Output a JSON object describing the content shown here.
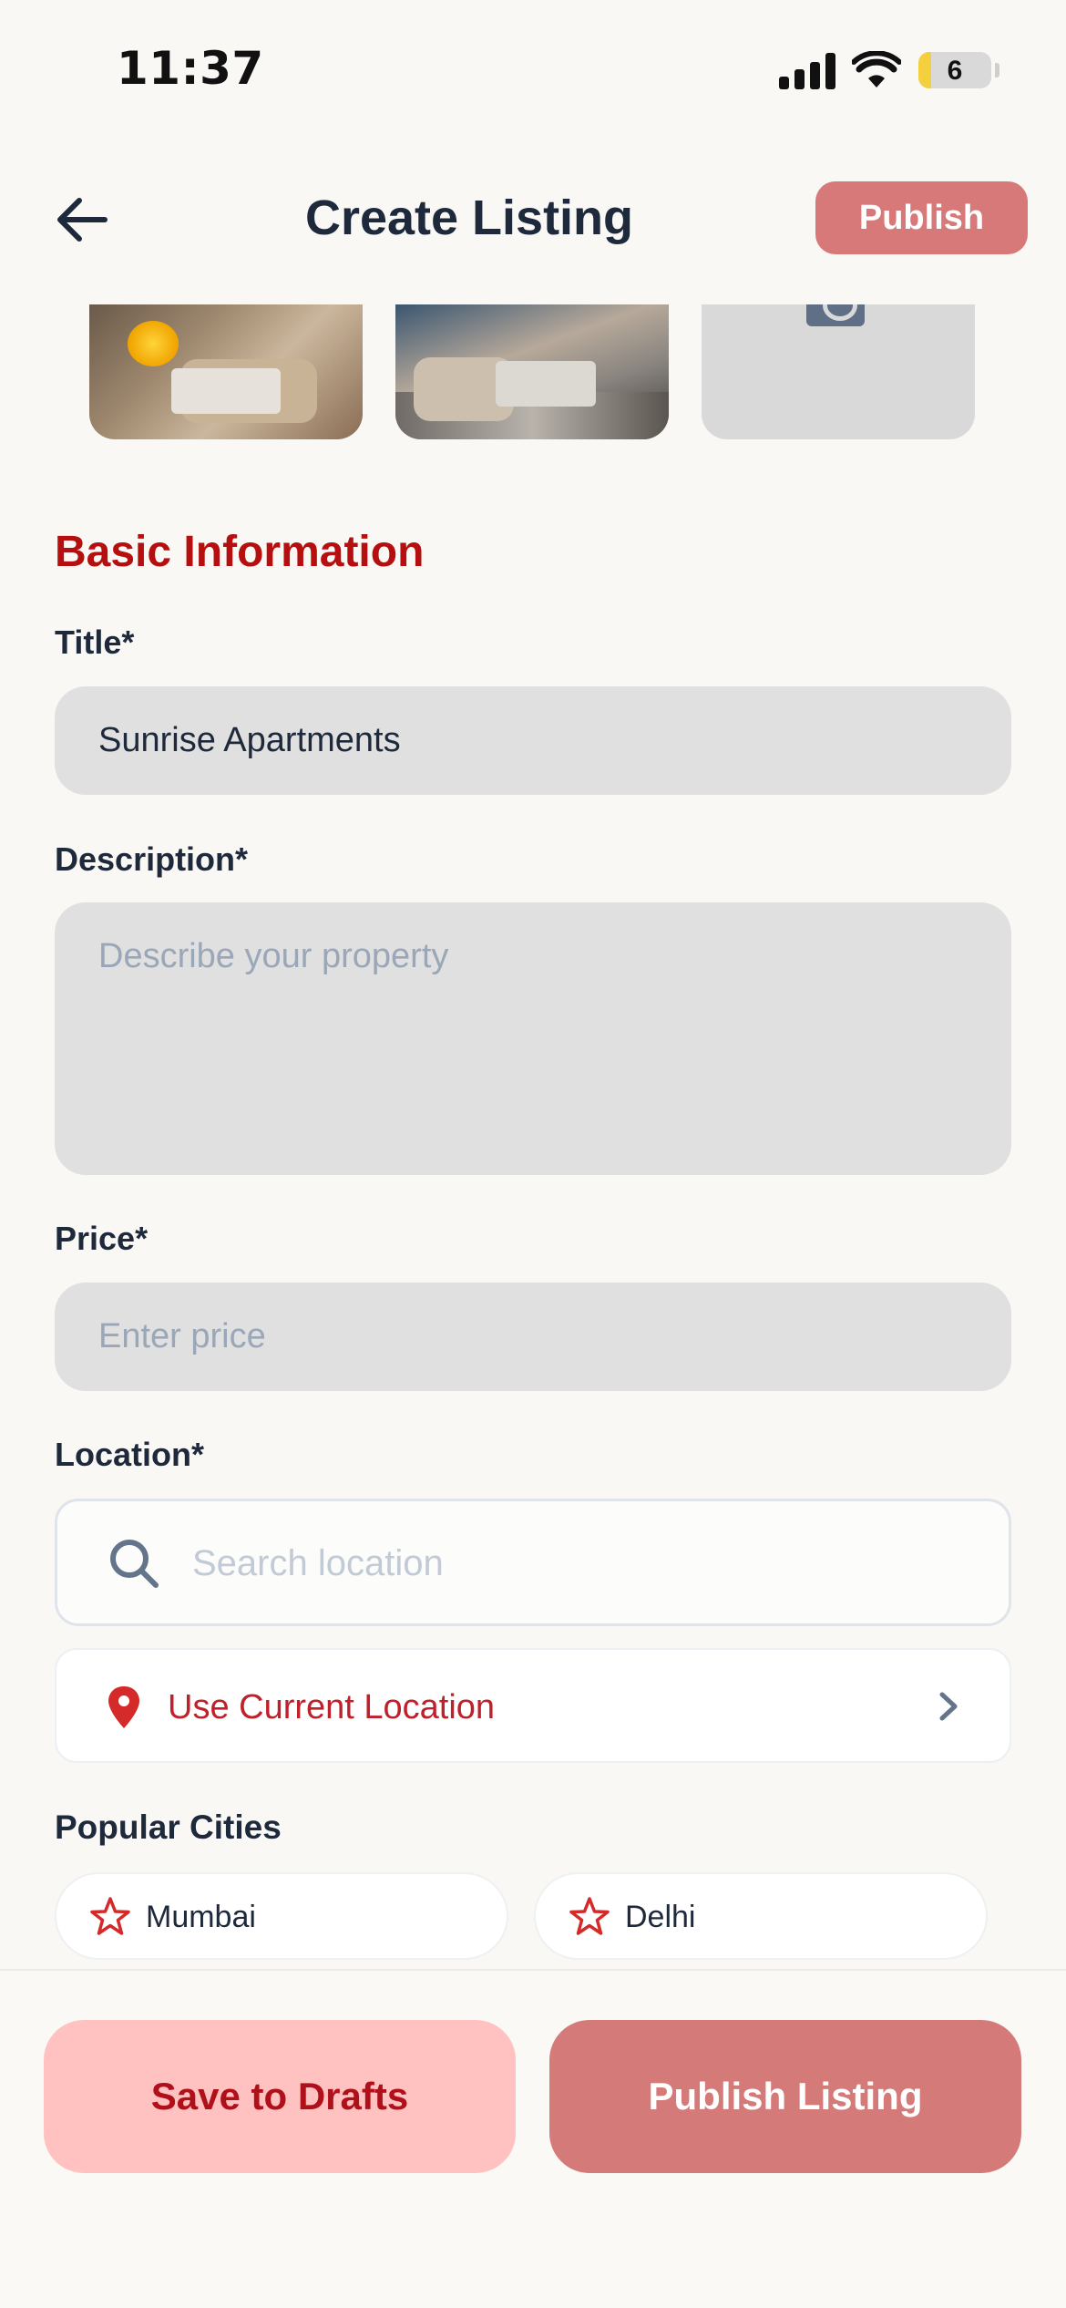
{
  "status_bar": {
    "time": "11:37",
    "battery_level": "6",
    "icons": [
      "signal-icon",
      "wifi-icon",
      "battery-icon"
    ]
  },
  "header": {
    "title": "Create Listing",
    "back_icon": "arrow-left-icon",
    "publish_label": "Publish"
  },
  "photos": {
    "items": [
      "living-room-photo",
      "living-room-photo",
      "add-photo-placeholder"
    ],
    "add_icon": "camera-icon"
  },
  "form": {
    "section_title": "Basic Information",
    "title": {
      "label": "Title*",
      "value": "Sunrise Apartments"
    },
    "description": {
      "label": "Description*",
      "placeholder": "Describe your property",
      "value": ""
    },
    "price": {
      "label": "Price*",
      "placeholder": "Enter price",
      "value": ""
    },
    "location": {
      "label": "Location*",
      "search_placeholder": "Search location",
      "current_location_label": "Use Current Location"
    },
    "popular_cities": {
      "label": "Popular Cities",
      "items": [
        {
          "label": "Mumbai",
          "icon": "star-icon"
        },
        {
          "label": "Delhi",
          "icon": "star-icon"
        }
      ]
    }
  },
  "footer": {
    "save_drafts_label": "Save to Drafts",
    "publish_listing_label": "Publish Listing"
  },
  "colors": {
    "accent_red": "#b50f0f",
    "publish_button": "#d47a78",
    "drafts_button": "#ffc2c1",
    "field_bg": "#e0e0e0",
    "background": "#f9f8f5"
  }
}
